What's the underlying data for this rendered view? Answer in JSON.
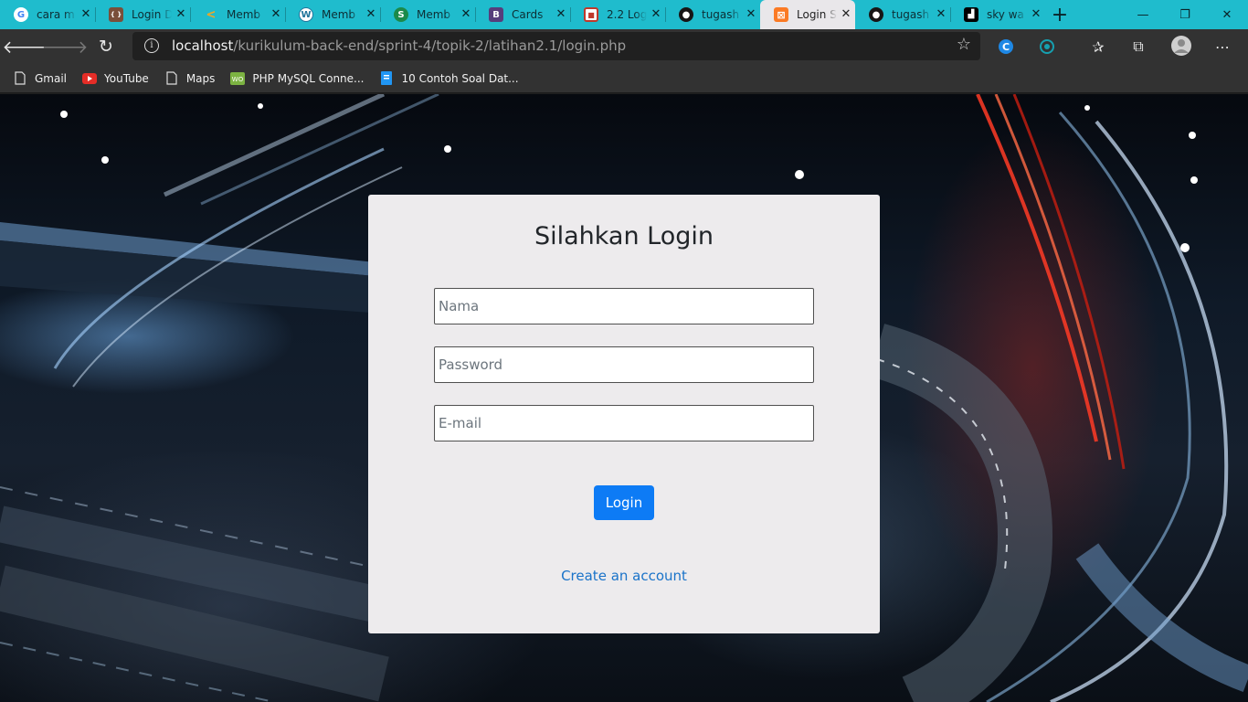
{
  "tabs": [
    {
      "title": "cara m",
      "icon": "google-icon",
      "color": "#ffffff"
    },
    {
      "title": "Login D",
      "icon": "php-login-icon",
      "color": "#7a4f3a"
    },
    {
      "title": "Memb",
      "icon": "code-icon",
      "color": "#2aa7d8"
    },
    {
      "title": "Memb",
      "icon": "wordpress-icon",
      "color": "#21759b"
    },
    {
      "title": "Memb",
      "icon": "s-logo-icon",
      "color": "#1b8a4a"
    },
    {
      "title": "Cards",
      "icon": "bootstrap-icon",
      "color": "#563d7c"
    },
    {
      "title": "2.2 Log",
      "icon": "app-icon",
      "color": "#c0392b"
    },
    {
      "title": "tugash",
      "icon": "github-icon",
      "color": "#171515"
    },
    {
      "title": "Login S",
      "icon": "xampp-icon",
      "color": "#fb7a24",
      "active": true
    },
    {
      "title": "tugash",
      "icon": "github-icon",
      "color": "#171515"
    },
    {
      "title": "sky wa",
      "icon": "sky-logo-icon",
      "color": "#000000"
    }
  ],
  "toolbar": {
    "url_host": "localhost",
    "url_path": "/kurikulum-back-end/sprint-4/topik-2/latihan2.1/login.php"
  },
  "bookmarks": [
    {
      "label": "Gmail",
      "icon": "page-icon"
    },
    {
      "label": "YouTube",
      "icon": "youtube-icon"
    },
    {
      "label": "Maps",
      "icon": "page-icon"
    },
    {
      "label": "PHP MySQL Conne...",
      "icon": "woo-icon"
    },
    {
      "label": "10 Contoh Soal Dat...",
      "icon": "doc-icon"
    }
  ],
  "form": {
    "title": "Silahkan Login",
    "name_placeholder": "Nama",
    "password_placeholder": "Password",
    "email_placeholder": "E-mail",
    "submit_label": "Login",
    "create_account_label": "Create an account"
  },
  "colors": {
    "tab_strip": "#1fbccd",
    "primary_button": "#0d7bf5",
    "link": "#1a73c9",
    "card_bg": "#edebed"
  }
}
